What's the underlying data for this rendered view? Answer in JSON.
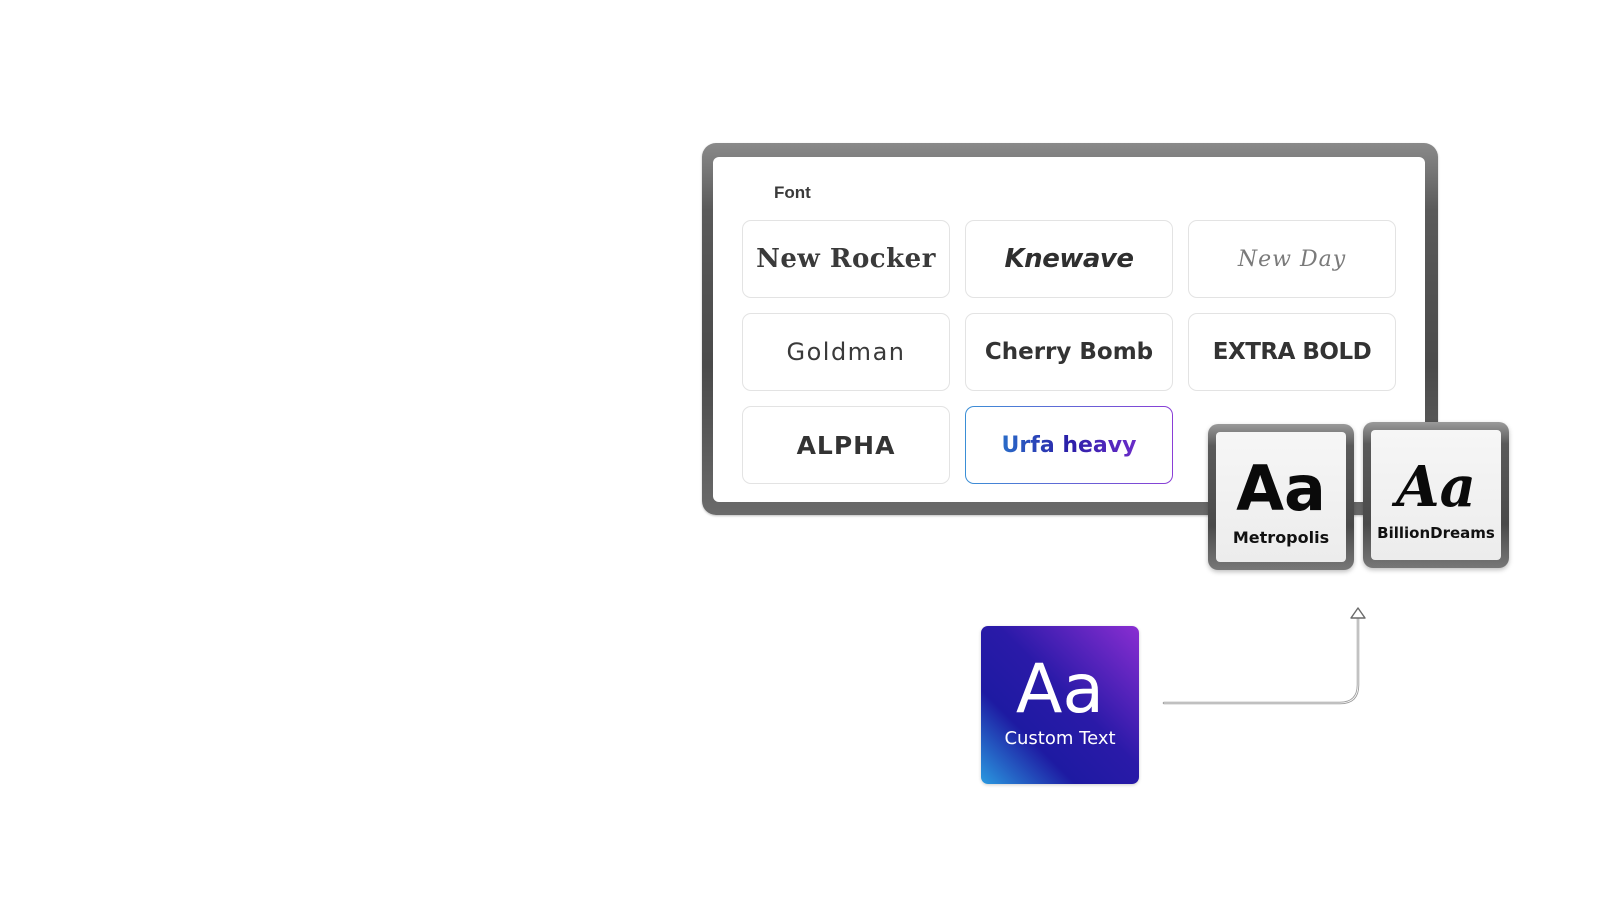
{
  "panel": {
    "title": "Font",
    "fonts": [
      {
        "label": "New Rocker"
      },
      {
        "label": "Knewave"
      },
      {
        "label": "New Day"
      },
      {
        "label": "Goldman"
      },
      {
        "label": "Cherry Bomb"
      },
      {
        "label": "EXTRA BOLD"
      },
      {
        "label": "ALPHA"
      },
      {
        "label": "Urfa heavy",
        "selected": true
      }
    ]
  },
  "tiles": [
    {
      "glyph": "Aa",
      "label": "Metropolis"
    },
    {
      "glyph": "Aa",
      "label": "BillionDreams"
    }
  ],
  "custom_text": {
    "glyph": "Aa",
    "label": "Custom Text",
    "colors": [
      "#8a2ed2",
      "#1e1aa2",
      "#2a9ae0"
    ]
  },
  "colors": {
    "frame": "#4a4a4a",
    "selection_gradient": [
      "#3a8fd6",
      "#8a3ed6"
    ]
  },
  "icons": {
    "arrow": "arrow-up-connector-icon"
  }
}
